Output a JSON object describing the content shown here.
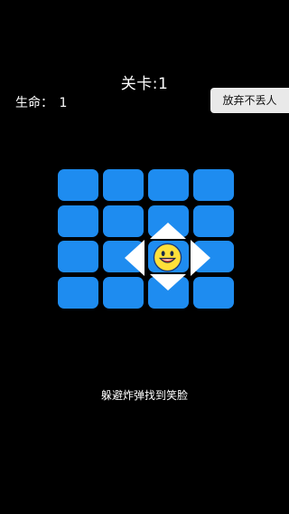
{
  "header": {
    "level_label": "关卡:1"
  },
  "status": {
    "lives_label": "生命：",
    "lives_value": "1"
  },
  "actions": {
    "give_up_label": "放弃不丢人"
  },
  "board": {
    "rows": 4,
    "cols": 4,
    "tile_color": "#1e8cf0",
    "player_row": 2,
    "player_col": 2,
    "player_icon": "smiley-face-icon",
    "controls": [
      "arrow-up-icon",
      "arrow-down-icon",
      "arrow-left-icon",
      "arrow-right-icon"
    ]
  },
  "hint": {
    "text": "躲避炸弹找到笑脸"
  },
  "colors": {
    "background": "#000000",
    "tile": "#1e8cf0",
    "button_bg": "#e9e9e9",
    "smiley_fill": "#ffe03a",
    "smiley_stroke": "#1a3a7a"
  }
}
